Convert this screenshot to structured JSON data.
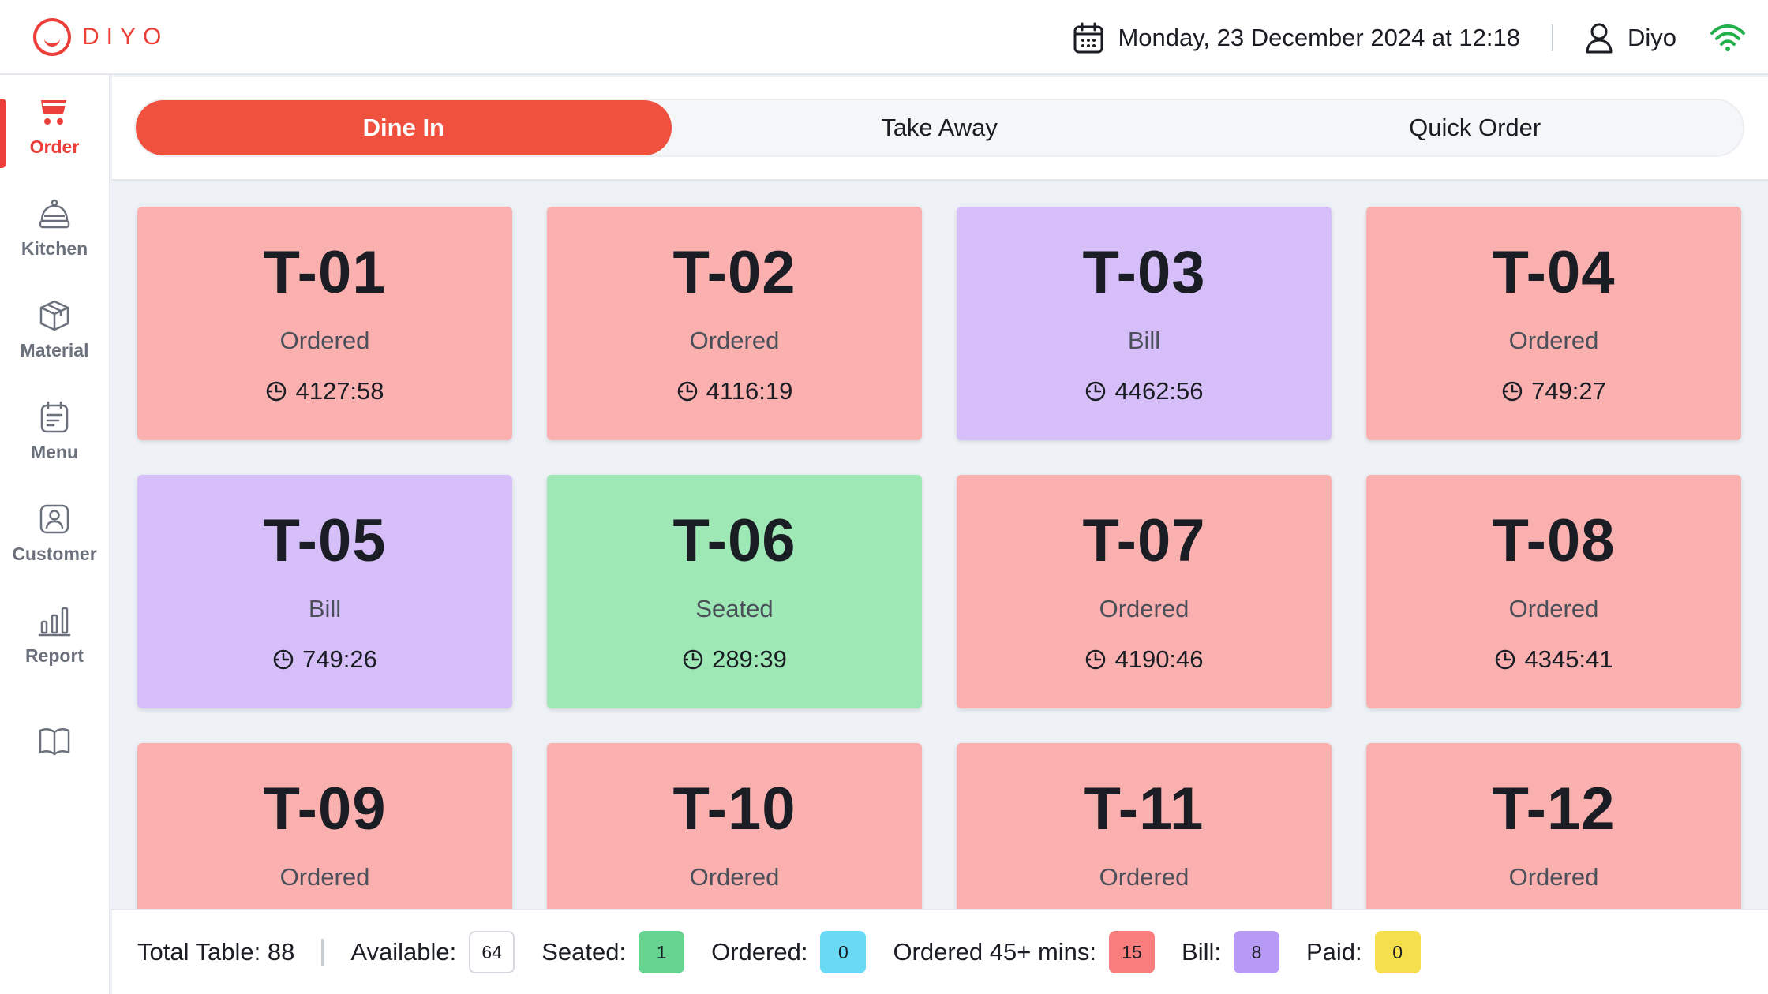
{
  "brand": {
    "logo_text": "DIYO",
    "accent": "#ec3f3a"
  },
  "header": {
    "datetime": "Monday, 23 December 2024 at 12:18",
    "username": "Diyo",
    "icons": [
      "calendar-icon",
      "user-icon",
      "wifi-icon"
    ]
  },
  "sidebar": {
    "items": [
      {
        "label": "Order",
        "icon": "cart-icon",
        "active": true
      },
      {
        "label": "Kitchen",
        "icon": "cloche-icon",
        "active": false
      },
      {
        "label": "Material",
        "icon": "box-icon",
        "active": false
      },
      {
        "label": "Menu",
        "icon": "menu-icon",
        "active": false
      },
      {
        "label": "Customer",
        "icon": "customer-icon",
        "active": false
      },
      {
        "label": "Report",
        "icon": "bar-chart-icon",
        "active": false
      },
      {
        "label": "",
        "icon": "book-icon",
        "active": false
      }
    ]
  },
  "tabs": [
    {
      "label": "Dine In",
      "active": true
    },
    {
      "label": "Take Away",
      "active": false
    },
    {
      "label": "Quick Order",
      "active": false
    }
  ],
  "tables": [
    {
      "name": "T-01",
      "status": "Ordered",
      "time": "4127:58",
      "color": "#fab0ae"
    },
    {
      "name": "T-02",
      "status": "Ordered",
      "time": "4116:19",
      "color": "#fab0ae"
    },
    {
      "name": "T-03",
      "status": "Bill",
      "time": "4462:56",
      "color": "#d6bff9"
    },
    {
      "name": "T-04",
      "status": "Ordered",
      "time": "749:27",
      "color": "#fab0ae"
    },
    {
      "name": "T-05",
      "status": "Bill",
      "time": "749:26",
      "color": "#d6bff9"
    },
    {
      "name": "T-06",
      "status": "Seated",
      "time": "289:39",
      "color": "#9de8b4"
    },
    {
      "name": "T-07",
      "status": "Ordered",
      "time": "4190:46",
      "color": "#fab0ae"
    },
    {
      "name": "T-08",
      "status": "Ordered",
      "time": "4345:41",
      "color": "#fab0ae"
    },
    {
      "name": "T-09",
      "status": "Ordered",
      "time": "",
      "color": "#fab0ae"
    },
    {
      "name": "T-10",
      "status": "Ordered",
      "time": "",
      "color": "#fab0ae"
    },
    {
      "name": "T-11",
      "status": "Ordered",
      "time": "",
      "color": "#fab0ae"
    },
    {
      "name": "T-12",
      "status": "Ordered",
      "time": "",
      "color": "#fab0ae"
    }
  ],
  "footer": {
    "total_label": "Total Table: 88",
    "stats": [
      {
        "label": "Available:",
        "value": "64",
        "color": "#ffffff"
      },
      {
        "label": "Seated:",
        "value": "1",
        "color": "#66d391"
      },
      {
        "label": "Ordered:",
        "value": "0",
        "color": "#6ad9f5"
      },
      {
        "label": "Ordered 45+ mins:",
        "value": "15",
        "color": "#f87e7e"
      },
      {
        "label": "Bill:",
        "value": "8",
        "color": "#b79af5"
      },
      {
        "label": "Paid:",
        "value": "0",
        "color": "#f5df4d"
      }
    ]
  }
}
